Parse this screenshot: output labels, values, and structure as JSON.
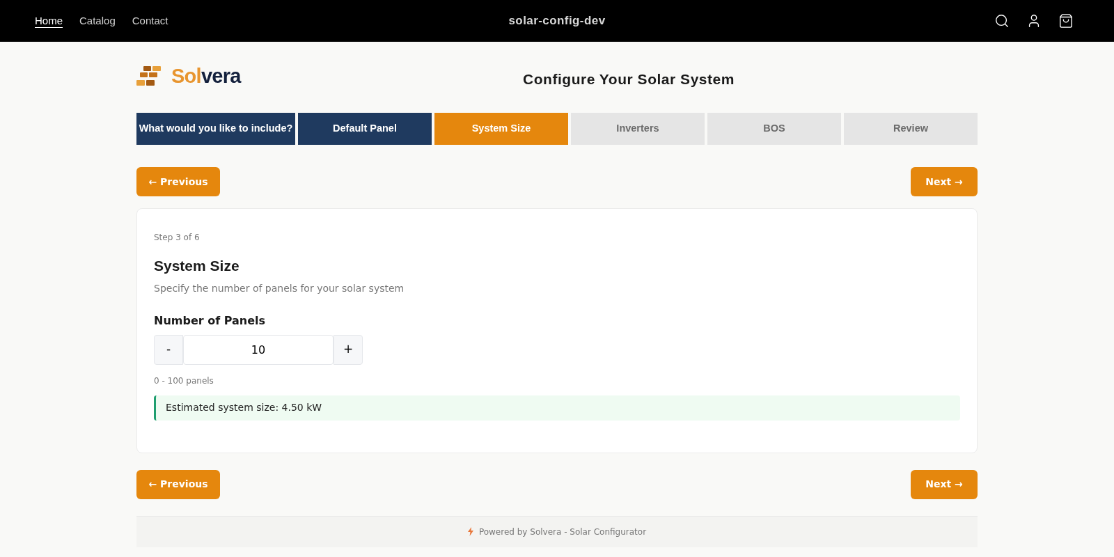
{
  "nav": {
    "links": [
      {
        "label": "Home",
        "selected": true
      },
      {
        "label": "Catalog",
        "selected": false
      },
      {
        "label": "Contact",
        "selected": false
      }
    ],
    "store_name": "solar-config-dev"
  },
  "logo": {
    "accent": "Sol",
    "rest": "vera"
  },
  "page_title": "Configure Your Solar System",
  "steps": [
    {
      "label": "What would you like to include?",
      "completed": true,
      "selected": false
    },
    {
      "label": "Default Panel",
      "completed": true,
      "selected": false
    },
    {
      "label": "System Size",
      "completed": false,
      "selected": true
    },
    {
      "label": "Inverters",
      "completed": false,
      "selected": false
    },
    {
      "label": "BOS",
      "completed": false,
      "selected": false
    },
    {
      "label": "Review",
      "completed": false,
      "selected": false
    }
  ],
  "top_buttons": {
    "previous": "← Previous",
    "next": "Next →"
  },
  "card": {
    "step_label": "Step 3 of 6",
    "title": "System Size",
    "subtitle": "Specify the number of panels for your solar system",
    "field_label": "Number of Panels",
    "decrement": "-",
    "value": "10",
    "increment": "+",
    "range_hint": "0 - 100 panels",
    "estimate": "Estimated system size: 4.50 kW"
  },
  "bottom_buttons": {
    "previous": "← Previous",
    "next": "Next →"
  },
  "footer": "Powered by Solvera - Solar Configurator"
}
